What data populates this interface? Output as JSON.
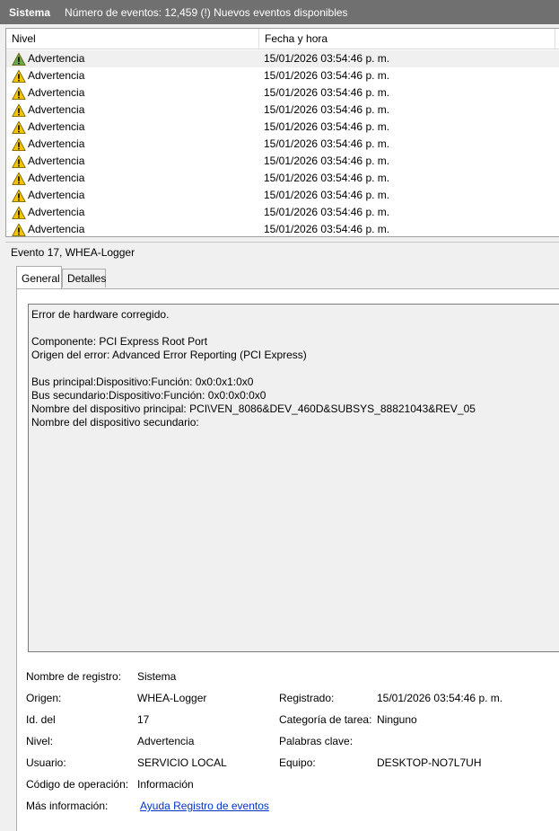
{
  "titlebar": {
    "log_name": "Sistema",
    "summary": "Número de eventos: 12,459 (!) Nuevos eventos disponibles"
  },
  "events_table": {
    "columns": [
      "Nivel",
      "Fecha y hora"
    ],
    "rows": [
      {
        "level": "Advertencia",
        "datetime": "15/01/2026 03:54:46 p. m.",
        "icon": "warning-icon-selected"
      },
      {
        "level": "Advertencia",
        "datetime": "15/01/2026 03:54:46 p. m.",
        "icon": "warning-icon"
      },
      {
        "level": "Advertencia",
        "datetime": "15/01/2026 03:54:46 p. m.",
        "icon": "warning-icon"
      },
      {
        "level": "Advertencia",
        "datetime": "15/01/2026 03:54:46 p. m.",
        "icon": "warning-icon"
      },
      {
        "level": "Advertencia",
        "datetime": "15/01/2026 03:54:46 p. m.",
        "icon": "warning-icon"
      },
      {
        "level": "Advertencia",
        "datetime": "15/01/2026 03:54:46 p. m.",
        "icon": "warning-icon"
      },
      {
        "level": "Advertencia",
        "datetime": "15/01/2026 03:54:46 p. m.",
        "icon": "warning-icon"
      },
      {
        "level": "Advertencia",
        "datetime": "15/01/2026 03:54:46 p. m.",
        "icon": "warning-icon"
      },
      {
        "level": "Advertencia",
        "datetime": "15/01/2026 03:54:46 p. m.",
        "icon": "warning-icon"
      },
      {
        "level": "Advertencia",
        "datetime": "15/01/2026 03:54:46 p. m.",
        "icon": "warning-icon"
      },
      {
        "level": "Advertencia",
        "datetime": "15/01/2026 03:54:46 p. m.",
        "icon": "warning-icon"
      }
    ]
  },
  "detail": {
    "header": "Evento 17, WHEA-Logger",
    "tabs": [
      "General",
      "Detalles"
    ],
    "description_lines": [
      "Error de hardware corregido.",
      "",
      "Componente: PCI Express Root Port",
      "Origen del error: Advanced Error Reporting (PCI Express)",
      "",
      "Bus principal:Dispositivo:Función: 0x0:0x1:0x0",
      "Bus secundario:Dispositivo:Función: 0x0:0x0:0x0",
      "Nombre del dispositivo principal: PCI\\VEN_8086&DEV_460D&SUBSYS_88821043&REV_05",
      "Nombre del dispositivo secundario:"
    ],
    "fields": {
      "log_name_label": "Nombre de registro:",
      "log_name_value": "Sistema",
      "source_label": "Origen:",
      "source_value": "WHEA-Logger",
      "logged_label": "Registrado:",
      "logged_value": "15/01/2026 03:54:46 p. m.",
      "event_id_label": "Id. del",
      "event_id_value": "17",
      "task_category_label": "Categoría de tarea:",
      "task_category_value": "Ninguno",
      "level_label": "Nivel:",
      "level_value": "Advertencia",
      "keywords_label": "Palabras clave:",
      "keywords_value": "",
      "user_label": "Usuario:",
      "user_value": "SERVICIO LOCAL",
      "computer_label": "Equipo:",
      "computer_value": "DESKTOP-NO7L7UH",
      "opcode_label": "Código de operación:",
      "opcode_value": "Información",
      "more_info_label": "Más información:",
      "more_info_link": "Ayuda Registro de eventos"
    }
  },
  "colors": {
    "titlebar_bg": "#707070",
    "warning_yellow": "#f5c400",
    "selected_icon_green": "#6aa84f",
    "link": "#0033cc"
  }
}
